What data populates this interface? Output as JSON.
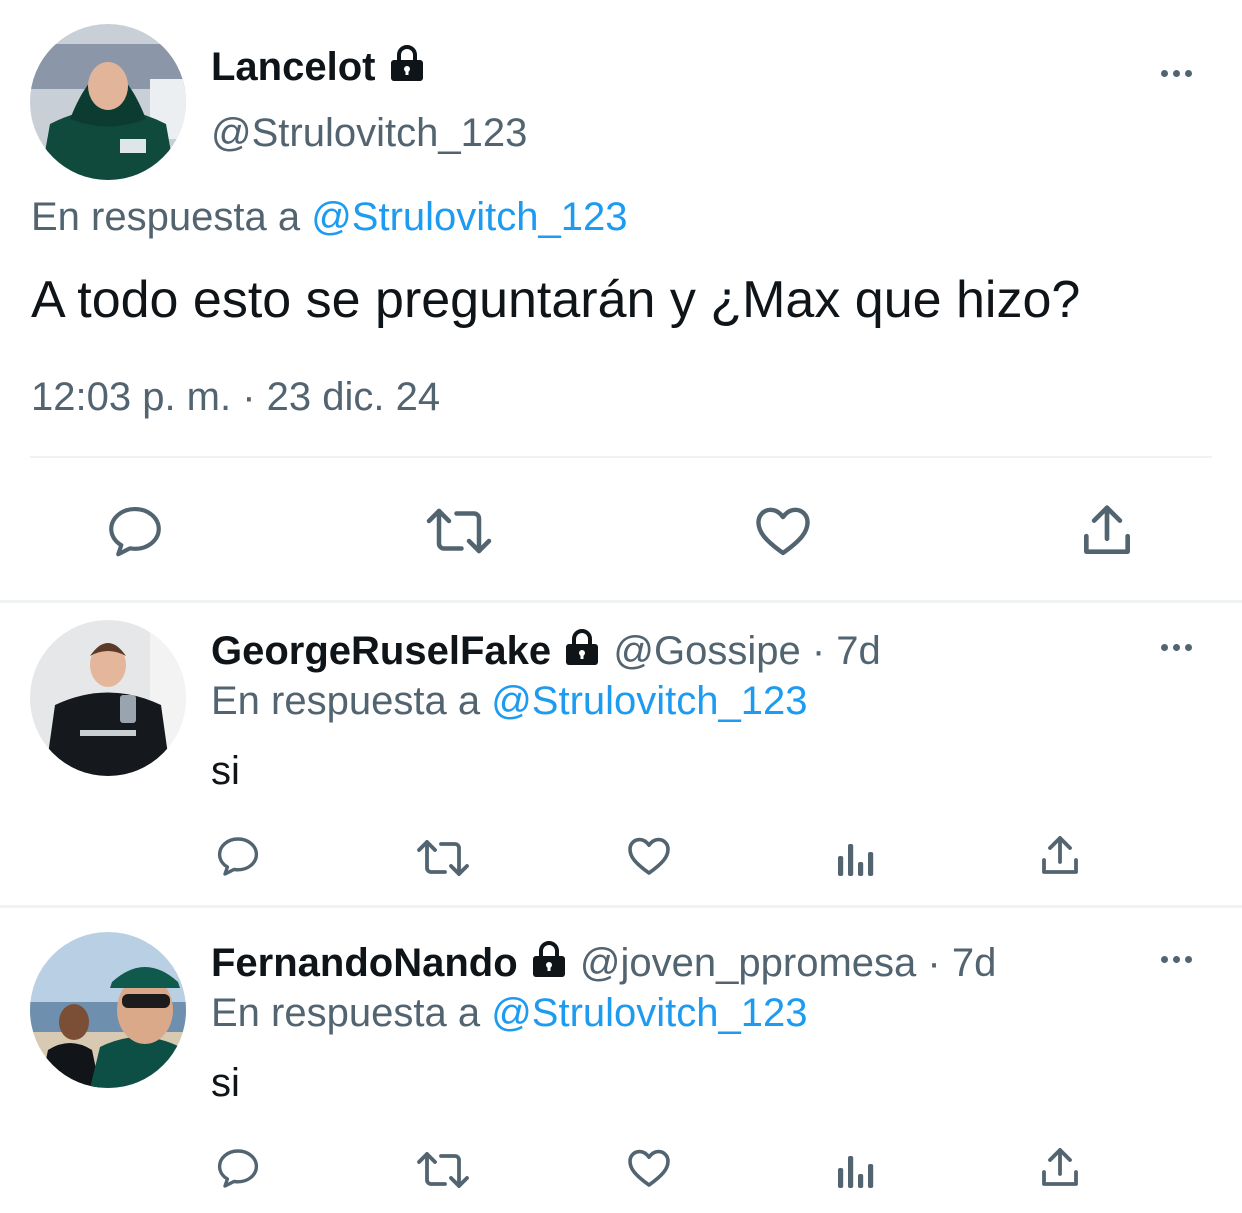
{
  "main_tweet": {
    "display_name": "Lancelot",
    "handle": "@Strulovitch_123",
    "reply_prefix": "En respuesta a",
    "reply_to": "@Strulovitch_123",
    "text": "A todo esto se preguntarán y ¿Max que hizo?",
    "timestamp": "12:03 p. m. · 23 dic. 24",
    "icons": [
      "reply-icon",
      "retweet-icon",
      "like-icon",
      "share-icon"
    ]
  },
  "replies": [
    {
      "display_name": "GeorgeRuselFake",
      "handle": "@Gossipe",
      "age": "· 7d",
      "reply_prefix": "En respuesta a",
      "reply_to": "@Strulovitch_123",
      "text": "si",
      "icons": [
        "reply-icon",
        "retweet-icon",
        "like-icon",
        "views-icon",
        "share-icon"
      ]
    },
    {
      "display_name": "FernandoNando",
      "handle": "@joven_ppromesa",
      "age": "· 7d",
      "reply_prefix": "En respuesta a",
      "reply_to": "@Strulovitch_123",
      "text": "si",
      "icons": [
        "reply-icon",
        "retweet-icon",
        "like-icon",
        "views-icon",
        "share-icon"
      ]
    }
  ],
  "colors": {
    "link": "#1d9bf0",
    "muted": "#536471",
    "text": "#0f1419",
    "divider": "#eff3f4"
  }
}
